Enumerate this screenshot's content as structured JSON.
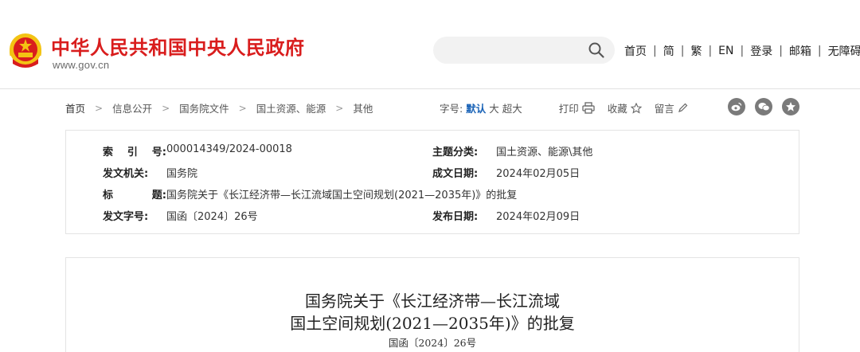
{
  "header": {
    "site_name": "中华人民共和国中央人民政府",
    "site_domain": "www.gov.cn",
    "search": {
      "value": "",
      "placeholder": ""
    },
    "nav_links": [
      "首页",
      "简",
      "繁",
      "EN",
      "登录",
      "邮箱",
      "无障碍"
    ],
    "separator": "|"
  },
  "breadcrumb": {
    "items": [
      "首页",
      "信息公开",
      "国务院文件",
      "国土资源、能源",
      "其他"
    ],
    "arrow": ">"
  },
  "toolbar": {
    "font_size_label": "字号:",
    "font_sizes": [
      "默认",
      "大",
      "超大"
    ],
    "active_font_size": "默认",
    "print_label": "打印",
    "favorite_label": "收藏",
    "comment_label": "留言"
  },
  "share": {
    "icons": [
      "weibo-icon",
      "wechat-icon",
      "qzone-icon"
    ]
  },
  "metadata": {
    "index_no": {
      "label": [
        "索",
        "引",
        "号:"
      ],
      "value": "000014349/2024-00018"
    },
    "topic": {
      "label": "主题分类:",
      "value": "国土资源、能源\\其他"
    },
    "issuer": {
      "label": "发文机关:",
      "value": "国务院"
    },
    "date_written": {
      "label": "成文日期:",
      "value": "2024年02月05日"
    },
    "title": {
      "label": [
        "标",
        "题:"
      ],
      "value": "国务院关于《长江经济带—长江流域国土空间规划(2021—2035年)》的批复"
    },
    "doc_no": {
      "label": "发文字号:",
      "value": "国函〔2024〕26号"
    },
    "publish_date": {
      "label": "发布日期:",
      "value": "2024年02月09日"
    }
  },
  "article": {
    "title_line1": "国务院关于《长江经济带—长江流域",
    "title_line2": "国土空间规划(2021—2035年)》的批复",
    "doc_no": "国函〔2024〕26号"
  },
  "colors": {
    "brand_red": "#d91d1d",
    "link_blue": "#1a63b7",
    "emblem_gold": "#f3c313"
  }
}
